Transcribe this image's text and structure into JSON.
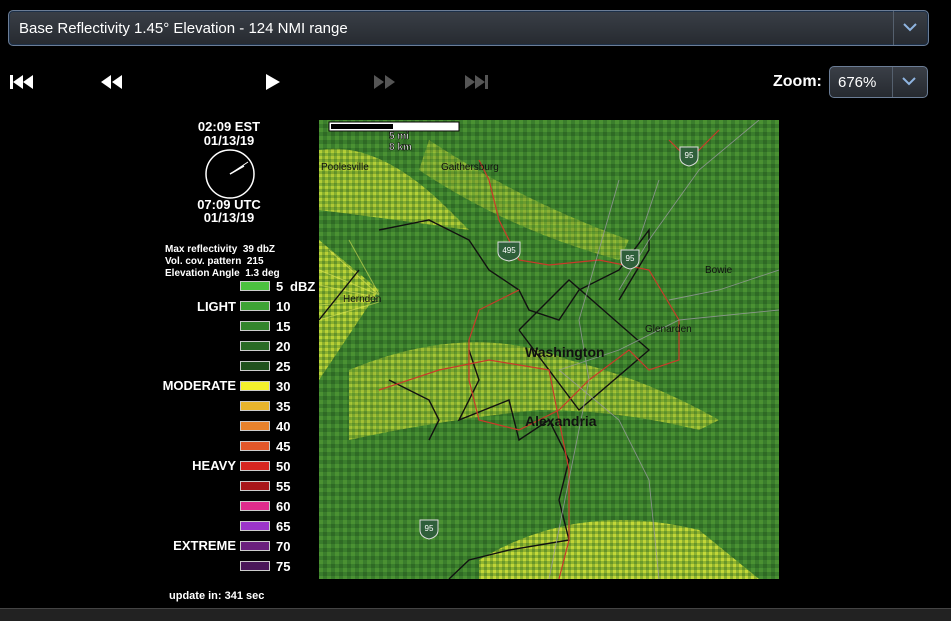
{
  "product_select": {
    "label": "Base Reflectivity 1.45° Elevation - 124 NMI range"
  },
  "controls": {
    "first": "skip-to-first",
    "back": "step-back",
    "play": "play",
    "forward": "step-forward",
    "last": "skip-to-last"
  },
  "zoom": {
    "label": "Zoom:",
    "value": "676%"
  },
  "time": {
    "local": "02:09 EST",
    "local_date": "01/13/19",
    "utc": "07:09 UTC",
    "utc_date": "01/13/19"
  },
  "info": {
    "line1": "Max reflectivity  39 dbZ",
    "line2": "Vol. cov. pattern  215",
    "line3": "Elevation Angle  1.3 deg"
  },
  "legend": {
    "categories": [
      "LIGHT",
      "MODERATE",
      "HEAVY",
      "EXTREME"
    ],
    "items": [
      {
        "value": "5",
        "unit": "dBZ",
        "color": "#4cc13f"
      },
      {
        "value": "10",
        "color": "#3ea335"
      },
      {
        "value": "15",
        "color": "#33852c"
      },
      {
        "value": "20",
        "color": "#2a6a25"
      },
      {
        "value": "25",
        "color": "#21511e"
      },
      {
        "value": "30",
        "color": "#f4f12c"
      },
      {
        "value": "35",
        "color": "#e8b42c"
      },
      {
        "value": "40",
        "color": "#e8822c"
      },
      {
        "value": "45",
        "color": "#e2572a"
      },
      {
        "value": "50",
        "color": "#d6261f"
      },
      {
        "value": "55",
        "color": "#a8171a"
      },
      {
        "value": "60",
        "color": "#e02b8c"
      },
      {
        "value": "65",
        "color": "#9b35c9"
      },
      {
        "value": "70",
        "color": "#6a1f7d"
      },
      {
        "value": "75",
        "color": "#4a1859"
      }
    ]
  },
  "map": {
    "scale_mi": "5  mi",
    "scale_km": "8  km",
    "places": [
      "Poolesville",
      "Gaithersburg",
      "Bowie",
      "Herndon",
      "Glenarden",
      "Washington",
      "Alexandria"
    ],
    "highways": [
      "95",
      "495",
      "95",
      "95"
    ]
  },
  "update": {
    "text": "update in: 341 sec"
  }
}
